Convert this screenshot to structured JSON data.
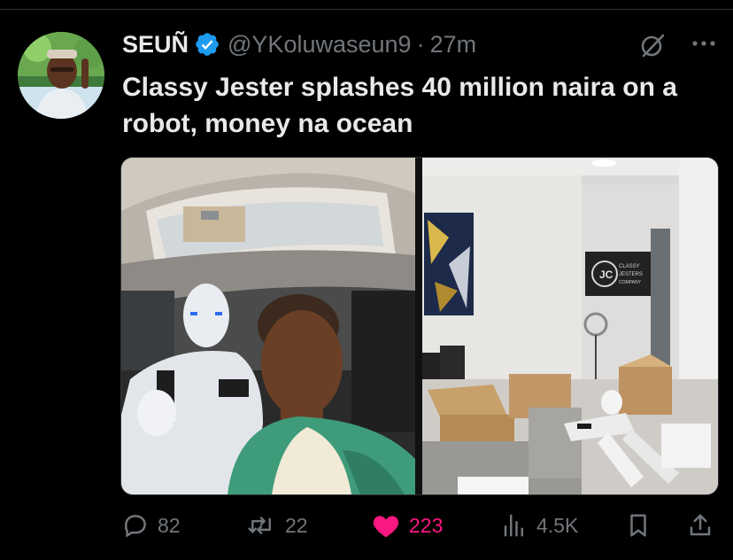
{
  "tweet": {
    "display_name": "SEUÑ",
    "handle": "@YKoluwaseun9",
    "separator": "·",
    "time": "27m",
    "text": "Classy Jester splashes 40 million naira on a robot, money na ocean",
    "verified": true
  },
  "media": {
    "left_image": "selfie-with-robot-in-car",
    "right_image": "robot-parts-in-boxes-in-office",
    "sign_text": [
      "CLASSY",
      "JESTERS",
      "COMPANY"
    ]
  },
  "actions": {
    "replies": "82",
    "reposts": "22",
    "likes": "223",
    "views": "4.5K",
    "liked": true
  },
  "icons": {
    "reply": "reply-icon",
    "repost": "repost-icon",
    "like": "heart-icon",
    "views": "views-icon",
    "bookmark": "bookmark-icon",
    "share": "share-icon"
  },
  "colors": {
    "background": "#000000",
    "text": "#e7e9ea",
    "muted": "#71767b",
    "verified": "#1d9bf0",
    "like": "#f91880"
  }
}
